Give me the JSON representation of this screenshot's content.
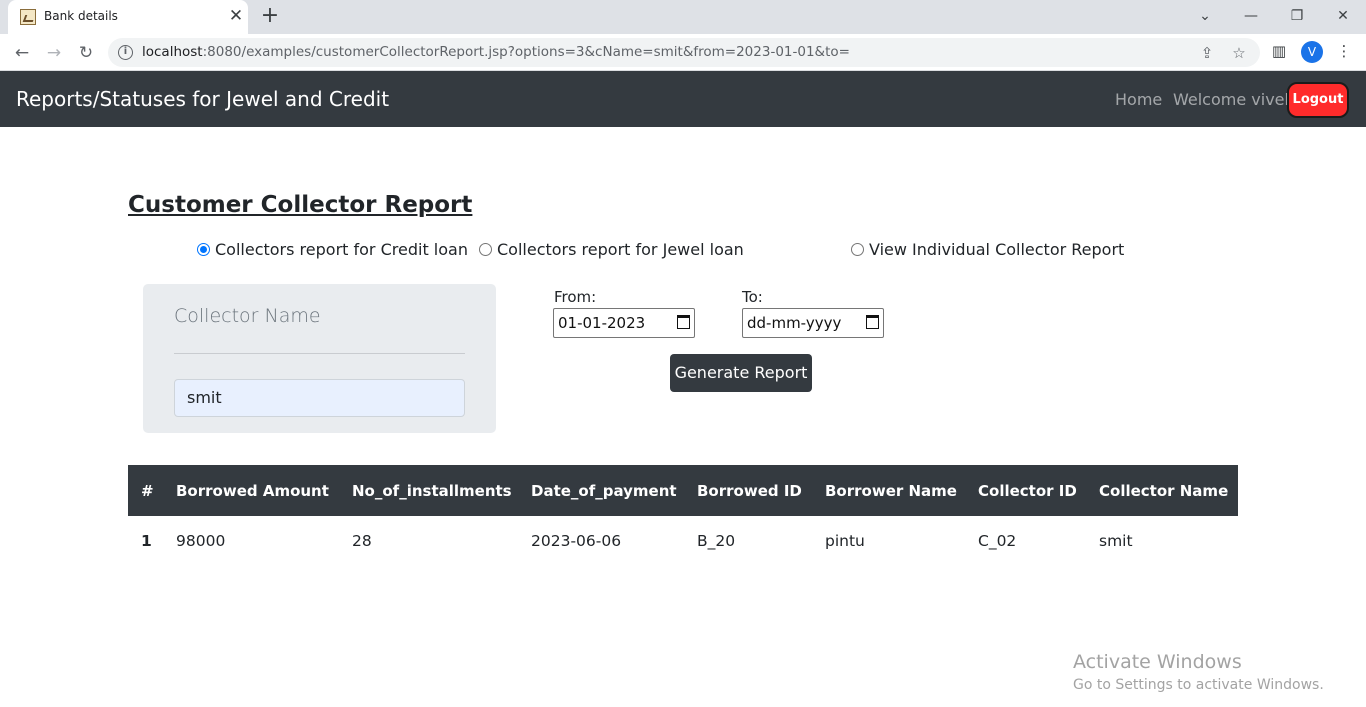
{
  "browser": {
    "tab_title": "Bank details",
    "new_tab_symbol": "+",
    "close_symbol": "✕",
    "url_host": "localhost",
    "url_rest": ":8080/examples/customerCollectorReport.jsp?options=3&cName=smit&from=2023-01-01&to=",
    "profile_initial": "V"
  },
  "navbar": {
    "brand": "Reports/Statuses for Jewel and Credit",
    "home": "Home",
    "welcome": "Welcome vivek",
    "logout": "Logout"
  },
  "page": {
    "title": "Customer Collector Report",
    "radios": [
      {
        "label": "Collectors report for Credit loan",
        "checked": true
      },
      {
        "label": "Collectors report for Jewel loan",
        "checked": false
      },
      {
        "label": "View Individual Collector Report",
        "checked": false
      }
    ],
    "collector_card": {
      "label": "Collector Name",
      "value": "smit"
    },
    "from_label": "From:",
    "from_value": "01-01-2023",
    "to_label": "To:",
    "to_value": "dd-mm-yyyy",
    "generate_button": "Generate Report"
  },
  "table": {
    "headers": [
      "#",
      "Borrowed Amount",
      "No_of_installments",
      "Date_of_payment",
      "Borrowed ID",
      "Borrower Name",
      "Collector ID",
      "Collector Name"
    ],
    "rows": [
      [
        "1",
        "98000",
        "28",
        "2023-06-06",
        "B_20",
        "pintu",
        "C_02",
        "smit"
      ]
    ]
  },
  "watermark": {
    "title": "Activate Windows",
    "subtitle": "Go to Settings to activate Windows."
  },
  "colors": {
    "navbar": "#343a40",
    "logout": "#ff2b2b",
    "radio_accent": "#0075ff",
    "card_bg": "#e9ecef",
    "input_autofill": "#e8f0fe"
  }
}
